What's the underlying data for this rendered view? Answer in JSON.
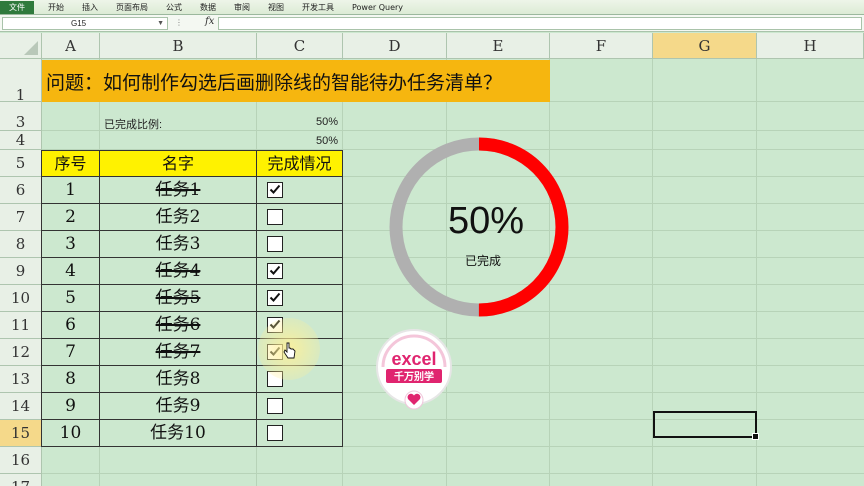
{
  "ribbon": {
    "tabs": [
      "文件",
      "开始",
      "插入",
      "页面布局",
      "公式",
      "数据",
      "审阅",
      "视图",
      "开发工具",
      "Power Query"
    ],
    "file_color": "#2f7a3c"
  },
  "formula_bar": {
    "name_box": "G15",
    "fx": "fx",
    "formula": ""
  },
  "grid": {
    "columns": [
      "A",
      "B",
      "C",
      "D",
      "E",
      "F",
      "G",
      "H"
    ],
    "rows": [
      "1",
      "3",
      "4",
      "5",
      "6",
      "7",
      "8",
      "9",
      "10",
      "11",
      "12",
      "13",
      "14",
      "15",
      "16",
      "17"
    ],
    "selected_column": "G",
    "selected_row": "15",
    "selected_cell": "G15"
  },
  "sheet": {
    "title": "问题：如何制作勾选后画删除线的智能待办任务清单？",
    "ratio_label": "已完成比例:",
    "ratio_value_1": "50%",
    "ratio_value_2": "50%",
    "table": {
      "headers": [
        "序号",
        "名字",
        "完成情况"
      ],
      "rows": [
        {
          "no": "1",
          "name": "任务1",
          "done": true
        },
        {
          "no": "2",
          "name": "任务2",
          "done": false
        },
        {
          "no": "3",
          "name": "任务3",
          "done": false
        },
        {
          "no": "4",
          "name": "任务4",
          "done": true
        },
        {
          "no": "5",
          "name": "任务5",
          "done": true
        },
        {
          "no": "6",
          "name": "任务6",
          "done": true
        },
        {
          "no": "7",
          "name": "任务7",
          "done": true
        },
        {
          "no": "8",
          "name": "任务8",
          "done": false
        },
        {
          "no": "9",
          "name": "任务9",
          "done": false
        },
        {
          "no": "10",
          "name": "任务10",
          "done": false
        }
      ]
    }
  },
  "donut": {
    "percent_text": "50%",
    "caption": "已完成",
    "fraction": 0.5,
    "done_color": "#ff0000",
    "rest_color": "#b0b0b0"
  },
  "logo": {
    "line1": "excel",
    "line2": "千万别学",
    "heart": "heart-icon"
  },
  "colors": {
    "sheet_bg": "#cce8cf",
    "title_fill": "#f6b60f",
    "header_fill": "#fff200"
  }
}
